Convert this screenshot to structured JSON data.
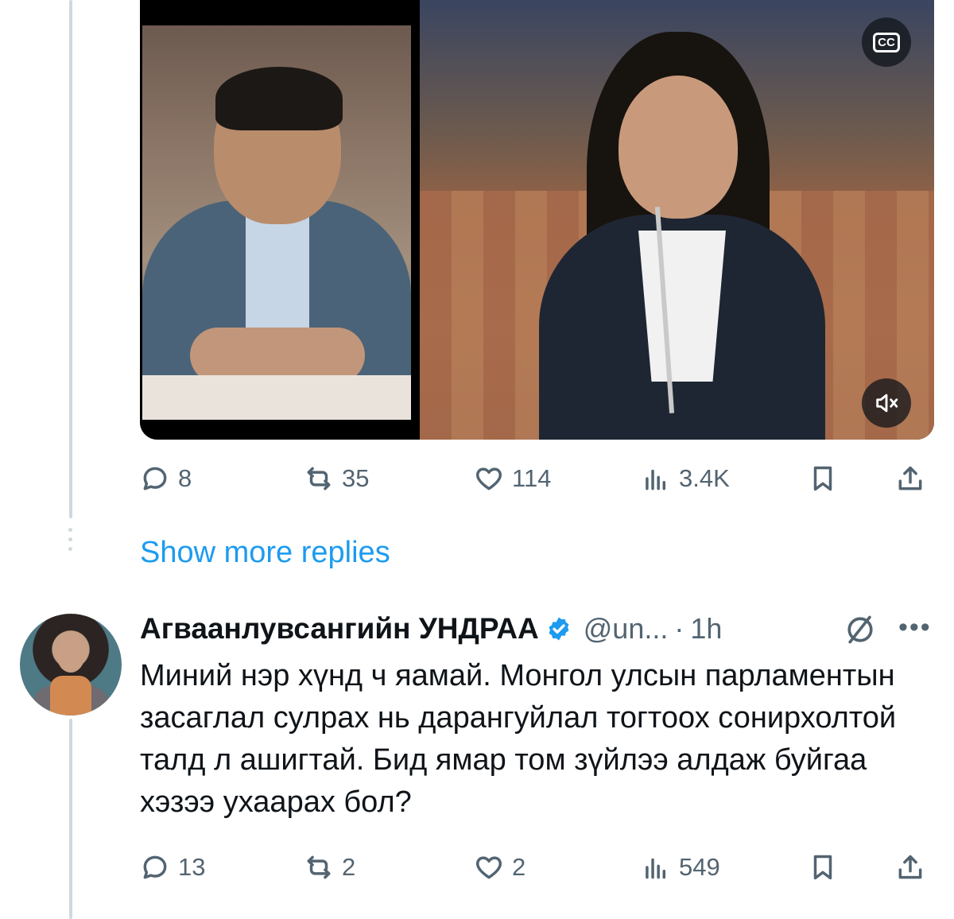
{
  "top_tweet": {
    "media": {
      "captions_icon": "cc-icon",
      "captions_label": "CC",
      "mute_icon": "mute-icon"
    },
    "stats": {
      "replies": "8",
      "reposts": "35",
      "likes": "114",
      "views": "3.4K"
    }
  },
  "show_more_replies": "Show more replies",
  "reply": {
    "author_name": "Агваанлувсангийн УНДРАА",
    "verified_icon": "verified-badge-icon",
    "handle": "@un...",
    "separator": "·",
    "time": "1h",
    "text": "Миний нэр хүнд ч яамай. Монгол улсын парламентын засаглал сулрах нь дарангуйлал тогтоох сонирхолтой талд л ашигтай. Бид ямар том зүйлээ алдаж буйгаа хэзээ ухаарах бол?",
    "stats": {
      "replies": "13",
      "reposts": "2",
      "likes": "2",
      "views": "549"
    }
  },
  "colors": {
    "accent": "#1d9bf0",
    "muted": "#536471",
    "thread_line": "#cfd9de"
  }
}
